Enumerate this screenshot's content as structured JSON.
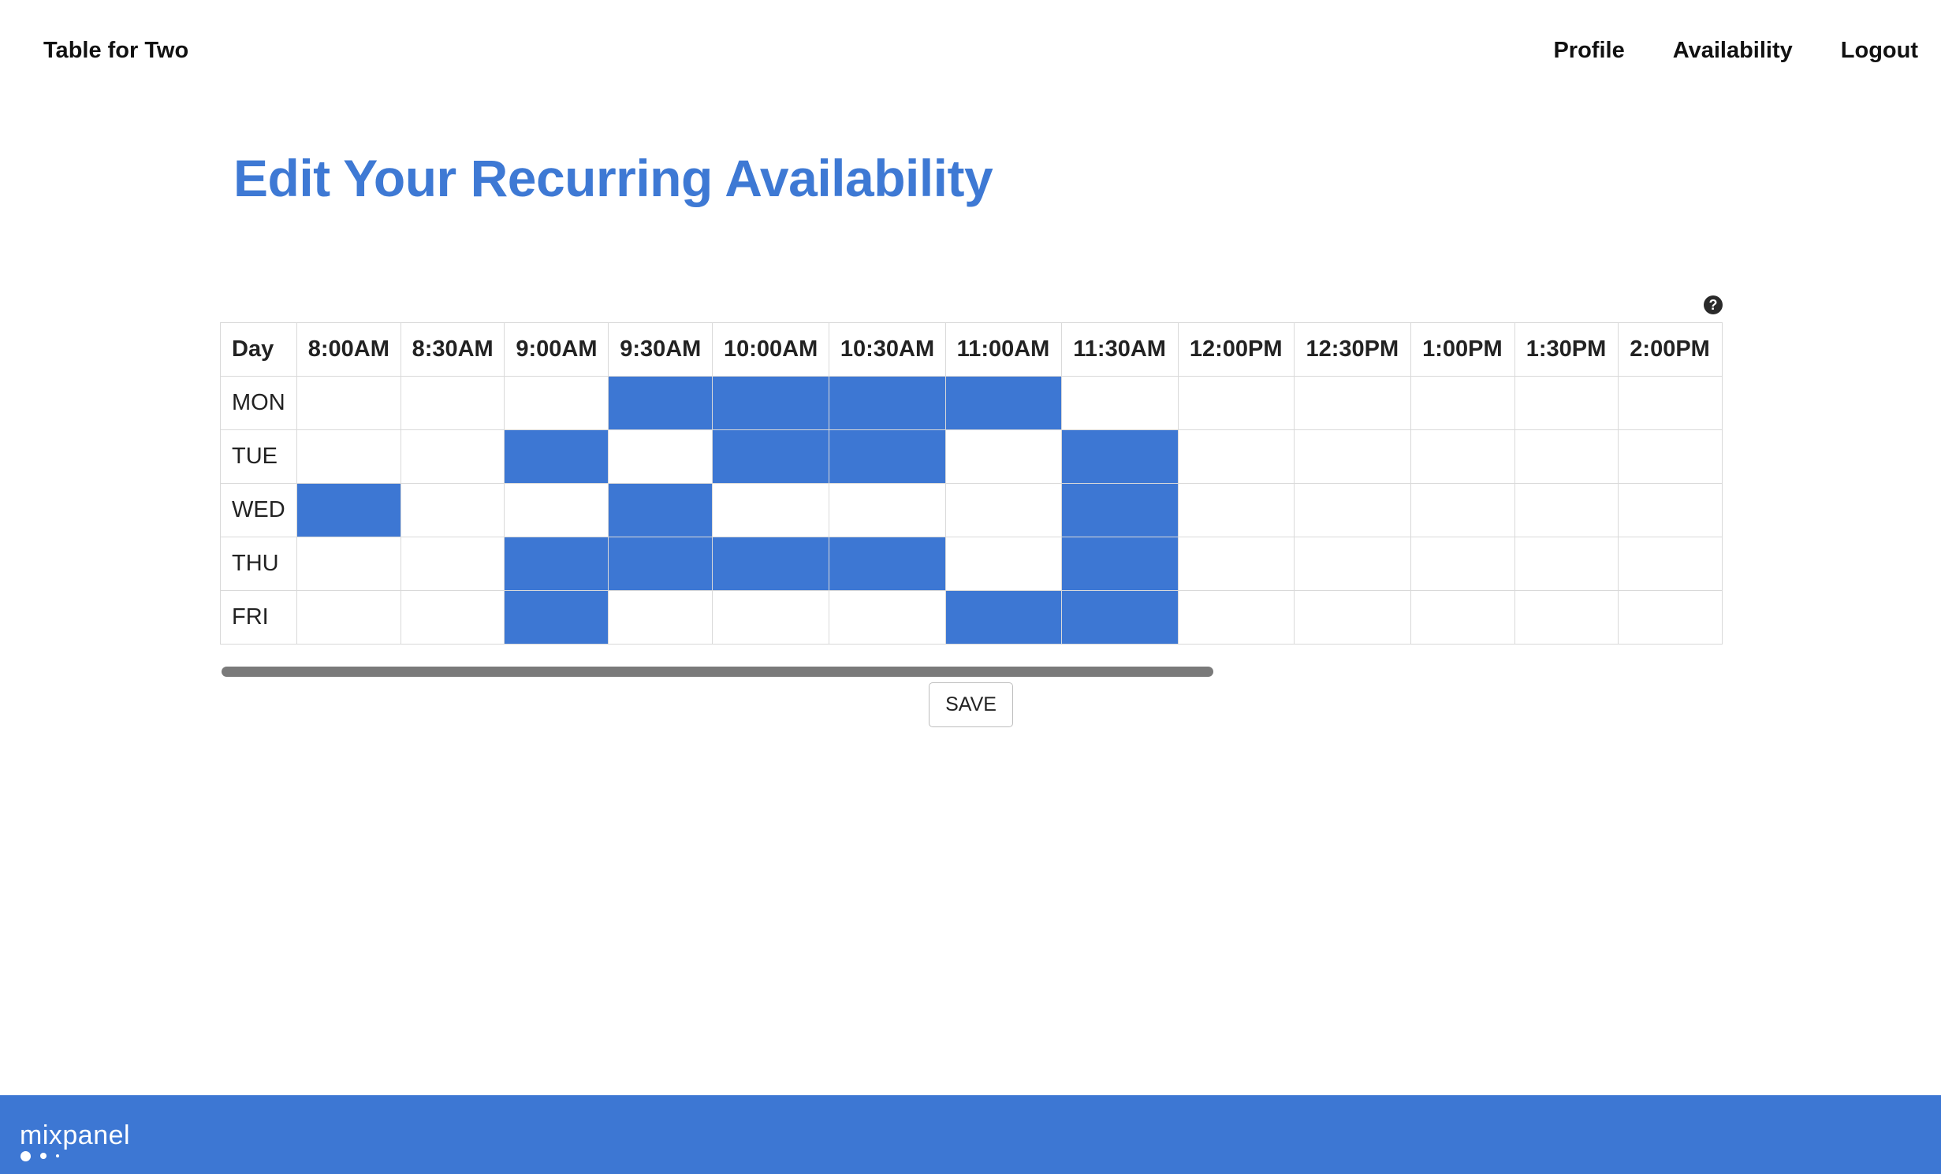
{
  "nav": {
    "brand": "Table for Two",
    "links": [
      "Profile",
      "Availability",
      "Logout"
    ]
  },
  "page": {
    "title": "Edit Your Recurring Availability",
    "help_icon": "question-circle-icon"
  },
  "schedule": {
    "day_header": "Day",
    "time_slots": [
      "8:00AM",
      "8:30AM",
      "9:00AM",
      "9:30AM",
      "10:00AM",
      "10:30AM",
      "11:00AM",
      "11:30AM",
      "12:00PM",
      "12:30PM",
      "1:00PM",
      "1:30PM",
      "2:00PM"
    ],
    "days": [
      {
        "label": "MON",
        "available": [
          false,
          false,
          false,
          true,
          true,
          true,
          true,
          false,
          false,
          false,
          false,
          false,
          false
        ]
      },
      {
        "label": "TUE",
        "available": [
          false,
          false,
          true,
          false,
          true,
          true,
          false,
          true,
          false,
          false,
          false,
          false,
          false
        ]
      },
      {
        "label": "WED",
        "available": [
          true,
          false,
          false,
          true,
          false,
          false,
          false,
          true,
          false,
          false,
          false,
          false,
          false
        ]
      },
      {
        "label": "THU",
        "available": [
          false,
          false,
          true,
          true,
          true,
          true,
          false,
          true,
          false,
          false,
          false,
          false,
          false
        ]
      },
      {
        "label": "FRI",
        "available": [
          false,
          false,
          true,
          false,
          false,
          false,
          true,
          true,
          false,
          false,
          false,
          false,
          false
        ]
      }
    ],
    "selected_color": "#3d77d3"
  },
  "actions": {
    "save_label": "SAVE"
  },
  "footer": {
    "logo_text": "mixpanel",
    "color": "#3d77d3"
  }
}
